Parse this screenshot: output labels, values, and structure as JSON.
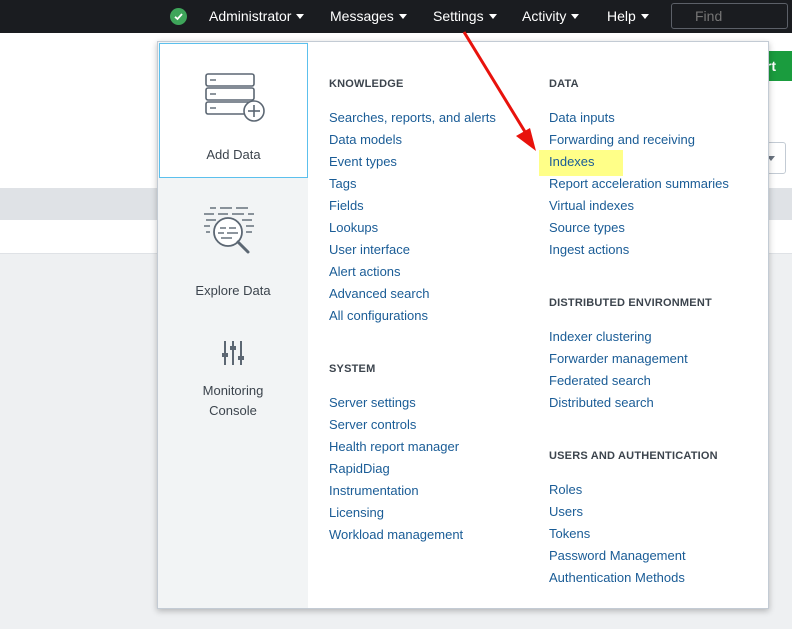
{
  "topbar": {
    "items": [
      {
        "label": "Administrator"
      },
      {
        "label": "Messages"
      },
      {
        "label": "Settings"
      },
      {
        "label": "Activity"
      },
      {
        "label": "Help"
      }
    ],
    "find_placeholder": "Find"
  },
  "background": {
    "green_button_label": "rt"
  },
  "menu": {
    "tiles": [
      {
        "label": "Add Data"
      },
      {
        "label": "Explore Data"
      },
      {
        "label": "Monitoring Console"
      }
    ],
    "knowledge": {
      "heading": "KNOWLEDGE",
      "links": [
        "Searches, reports, and alerts",
        "Data models",
        "Event types",
        "Tags",
        "Fields",
        "Lookups",
        "User interface",
        "Alert actions",
        "Advanced search",
        "All configurations"
      ]
    },
    "system": {
      "heading": "SYSTEM",
      "links": [
        "Server settings",
        "Server controls",
        "Health report manager",
        "RapidDiag",
        "Instrumentation",
        "Licensing",
        "Workload management"
      ]
    },
    "data": {
      "heading": "DATA",
      "links": [
        "Data inputs",
        "Forwarding and receiving",
        "Indexes",
        "Report acceleration summaries",
        "Virtual indexes",
        "Source types",
        "Ingest actions"
      ]
    },
    "distributed": {
      "heading": "DISTRIBUTED ENVIRONMENT",
      "links": [
        "Indexer clustering",
        "Forwarder management",
        "Federated search",
        "Distributed search"
      ]
    },
    "users": {
      "heading": "USERS AND AUTHENTICATION",
      "links": [
        "Roles",
        "Users",
        "Tokens",
        "Password Management",
        "Authentication Methods"
      ]
    }
  },
  "colors": {
    "topbar": "#1a1c20",
    "link": "#1a5c96",
    "highlight": "#ffff88",
    "arrow": "#e8120c",
    "status_ok": "#3ea55a"
  }
}
